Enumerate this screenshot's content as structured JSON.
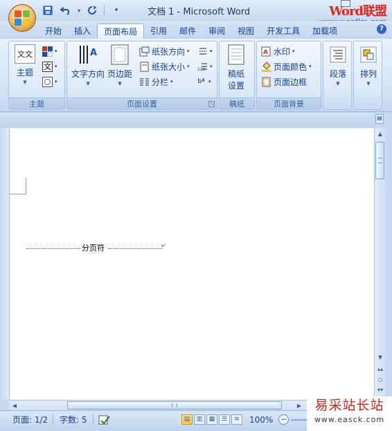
{
  "titlebar": {
    "document_title": "文档 1 - Microsoft Word",
    "qat": {
      "save_icon": "save-icon",
      "undo_icon": "undo-icon",
      "redo_icon": "redo-icon",
      "customize_icon": "dropdown-icon"
    }
  },
  "watermark_top": {
    "brand": "Word联盟",
    "url": "www.wordlm.com"
  },
  "tabs": [
    {
      "label": "开始"
    },
    {
      "label": "插入"
    },
    {
      "label": "页面布局",
      "active": true
    },
    {
      "label": "引用"
    },
    {
      "label": "邮件"
    },
    {
      "label": "审阅"
    },
    {
      "label": "视图"
    },
    {
      "label": "开发工具"
    },
    {
      "label": "加载项"
    }
  ],
  "ribbon": {
    "themes": {
      "group_label": "主题",
      "theme_button": "主题",
      "colors_icon": "theme-colors-icon",
      "fonts_icon": "theme-fonts-icon",
      "effects_icon": "theme-effects-icon",
      "theme_icon_text": "文文"
    },
    "page_setup": {
      "group_label": "页面设置",
      "text_direction": "文字方向",
      "margins": "页边距",
      "orientation": "纸张方向",
      "size": "纸张大小",
      "columns": "分栏",
      "breaks_icon": "breaks-icon",
      "line_numbers_icon": "line-numbers-icon",
      "hyphenation_icon": "hyphenation-icon"
    },
    "manuscript": {
      "group_label": "稿纸",
      "button_line1": "稿纸",
      "button_line2": "设置"
    },
    "page_background": {
      "group_label": "页面背景",
      "watermark": "水印",
      "page_color": "页面颜色",
      "page_borders": "页面边框"
    },
    "paragraph": {
      "button": "段落"
    },
    "arrange": {
      "button": "排列"
    }
  },
  "document": {
    "page_break_label": "分页符"
  },
  "statusbar": {
    "page": "页面: 1/2",
    "words": "字数: 5",
    "zoom": "100%"
  },
  "watermark_bottom": {
    "title": "易采站长站",
    "url": "www.easck.com"
  },
  "colors": {
    "accent": "#15428b",
    "ribbon_bg": "#dde9f7",
    "watermark_red": "#c8241c"
  }
}
